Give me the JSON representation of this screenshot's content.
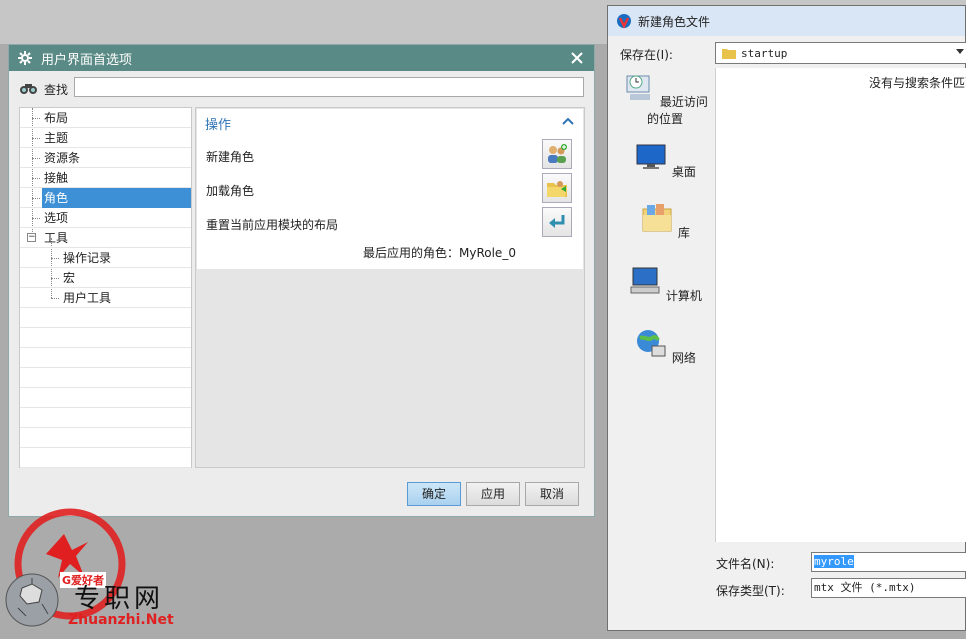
{
  "prefs": {
    "title": "用户界面首选项",
    "search_label": "查找",
    "search_value": "",
    "tree": [
      {
        "label": "布局",
        "child": false
      },
      {
        "label": "主题",
        "child": false
      },
      {
        "label": "资源条",
        "child": false
      },
      {
        "label": "接触",
        "child": false
      },
      {
        "label": "角色",
        "child": false,
        "selected": true
      },
      {
        "label": "选项",
        "child": false
      },
      {
        "label": "工具",
        "child": false,
        "expanded": true
      },
      {
        "label": "操作记录",
        "child": true
      },
      {
        "label": "宏",
        "child": true
      },
      {
        "label": "用户工具",
        "child": true
      }
    ],
    "section_title": "操作",
    "ops": {
      "new_role": "新建角色",
      "load_role": "加载角色",
      "reset_layout": "重置当前应用模块的布局"
    },
    "last_role": "最后应用的角色：MyRole_0",
    "buttons": {
      "ok": "确定",
      "apply": "应用",
      "cancel": "取消"
    }
  },
  "save": {
    "title": "新建角色文件",
    "lookin_label": "保存在(I):",
    "lookin_value": "startup",
    "places": [
      "最近访问的位置",
      "桌面",
      "库",
      "计算机",
      "网络"
    ],
    "empty_message": "没有与搜索条件匹配的项。",
    "filename_label": "文件名(N):",
    "filename_value": "myrole",
    "filetype_label": "保存类型(T):",
    "filetype_value": "mtx 文件 (*.mtx)"
  },
  "watermark": {
    "text": "专职网",
    "url": "Zhuanzhi.Net",
    "badge": "G爱好者"
  },
  "colors": {
    "title_bar": "#5a8a85",
    "selection": "#3d8fd6",
    "section_title": "#2f74b5"
  }
}
